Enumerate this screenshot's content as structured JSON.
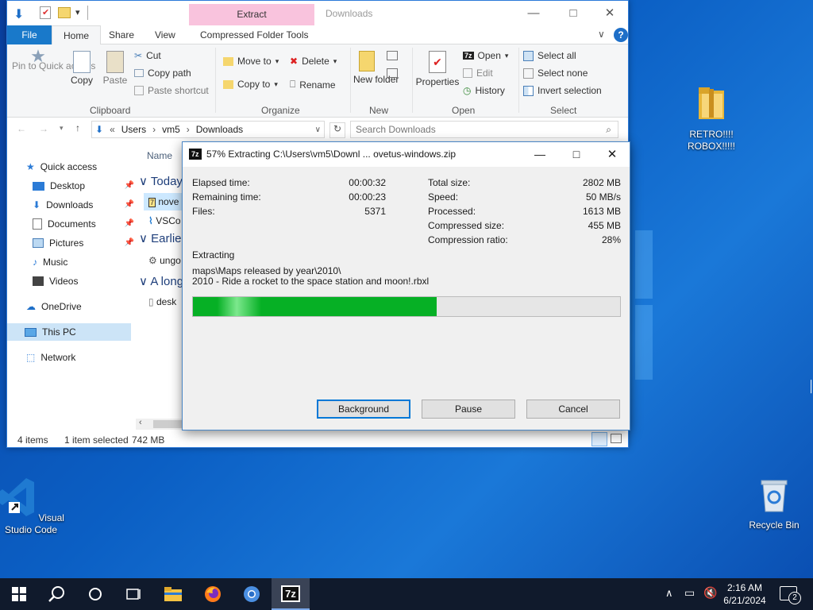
{
  "explorer": {
    "title": "Downloads",
    "context_tab": "Extract",
    "tabs": [
      "File",
      "Home",
      "Share",
      "View",
      "Compressed Folder Tools"
    ],
    "ribbon": {
      "pin_label": "Pin to Quick access",
      "copy": "Copy",
      "paste": "Paste",
      "cut": "Cut",
      "copy_path": "Copy path",
      "paste_shortcut": "Paste shortcut",
      "clipboard_group": "Clipboard",
      "move_to": "Move to",
      "copy_to": "Copy to",
      "delete": "Delete",
      "rename": "Rename",
      "organize_group": "Organize",
      "new_folder": "New folder",
      "new_group": "New",
      "properties": "Properties",
      "open": "Open",
      "edit": "Edit",
      "history": "History",
      "open_group": "Open",
      "select_all": "Select all",
      "select_none": "Select none",
      "invert_selection": "Invert selection",
      "select_group": "Select"
    },
    "address": {
      "crumbs": [
        "Users",
        "vm5",
        "Downloads"
      ],
      "search_placeholder": "Search Downloads"
    },
    "nav": {
      "quick_access": "Quick access",
      "desktop": "Desktop",
      "downloads": "Downloads",
      "documents": "Documents",
      "pictures": "Pictures",
      "music": "Music",
      "videos": "Videos",
      "onedrive": "OneDrive",
      "this_pc": "This PC",
      "network": "Network"
    },
    "files": {
      "name_header": "Name",
      "group_today": "Today",
      "file1": "nove",
      "file2": "VSCo",
      "group_earlier": "Earlier",
      "file3": "ungo",
      "group_long": "A long",
      "file4": "desk"
    },
    "status": {
      "items": "4 items",
      "selected": "1 item selected",
      "size": "742 MB"
    }
  },
  "dialog": {
    "app_icon": "7z",
    "title": "57% Extracting C:\\Users\\vm5\\Downl ... ovetus-windows.zip",
    "left_stats": [
      {
        "label": "Elapsed time:",
        "value": "00:00:32"
      },
      {
        "label": "Remaining time:",
        "value": "00:00:23"
      },
      {
        "label": "Files:",
        "value": "5371"
      }
    ],
    "right_stats": [
      {
        "label": "Total size:",
        "value": "2802 MB"
      },
      {
        "label": "Speed:",
        "value": "50 MB/s"
      },
      {
        "label": "Processed:",
        "value": "1613 MB"
      },
      {
        "label": "Compressed size:",
        "value": "455 MB"
      },
      {
        "label": "Compression ratio:",
        "value": "28%"
      }
    ],
    "status_label": "Extracting",
    "path_line1": "maps\\Maps released by year\\2010\\",
    "path_line2": "2010 - Ride a rocket to the space station and moon!.rbxl",
    "progress": 0.57,
    "buttons": {
      "background": "Background",
      "pause": "Pause",
      "cancel": "Cancel"
    }
  },
  "desktop": {
    "icon_retro": "RETRO!!!! ROBOX!!!!!",
    "icon_vscode": "Visual Studio Code",
    "icon_recycle": "Recycle Bin"
  },
  "taskbar": {
    "time": "2:16 AM",
    "date": "6/21/2024",
    "notification_count": "2"
  },
  "colors": {
    "accent": "#0078d7",
    "progress": "#06b025",
    "file_tab": "#1979ca",
    "context_tab": "#f9c3dd",
    "taskbar": "#101a2c"
  }
}
